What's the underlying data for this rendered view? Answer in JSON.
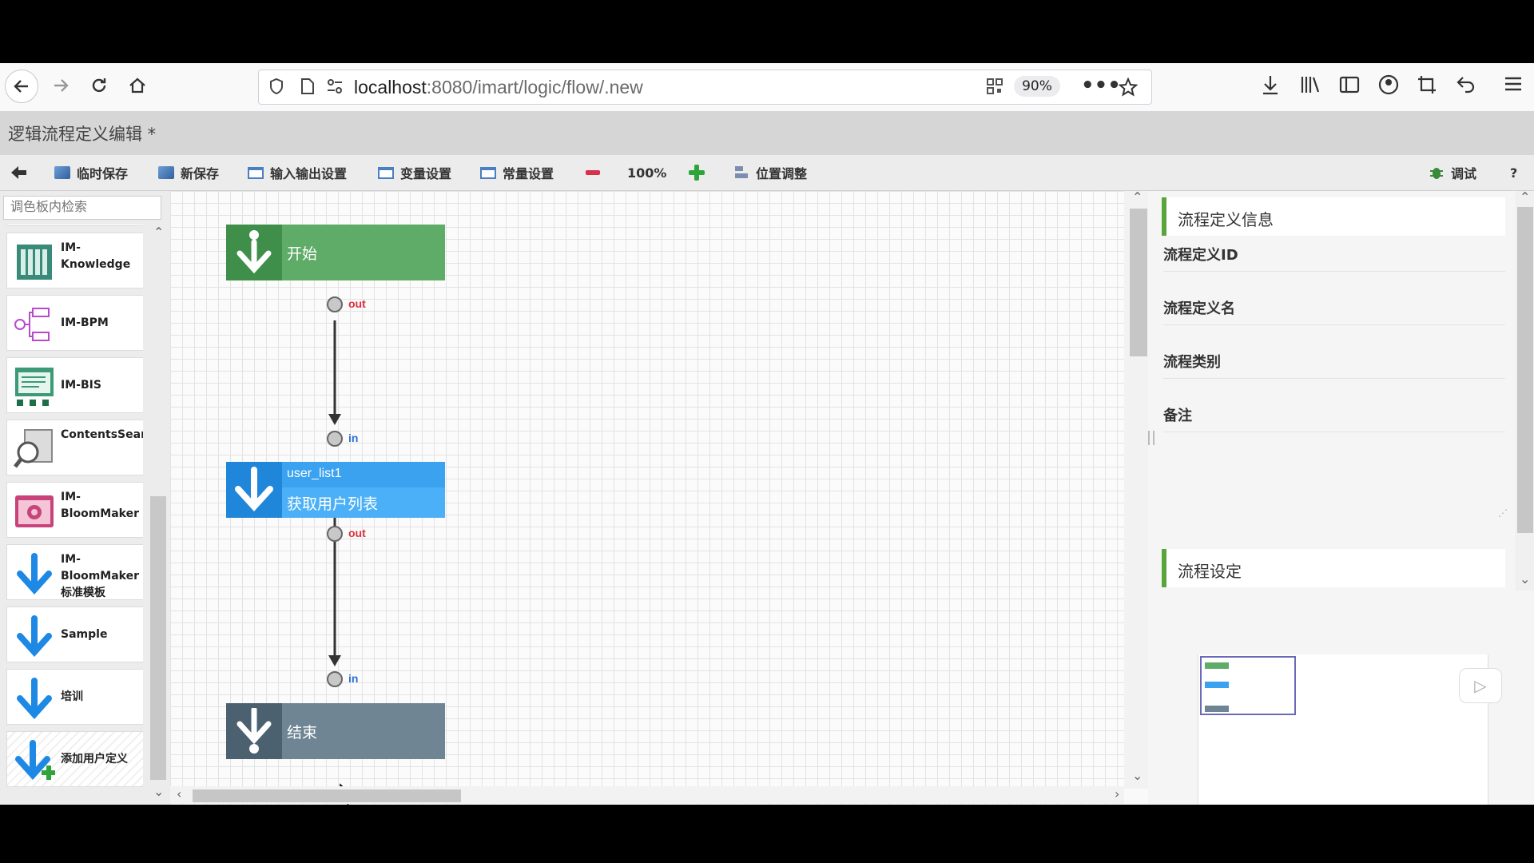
{
  "browser": {
    "url_host": "localhost",
    "url_path": ":8080/imart/logic/flow/.new",
    "zoom": "90%"
  },
  "page": {
    "title": "逻辑流程定义编辑 *"
  },
  "toolbar": {
    "temp_save": "临时保存",
    "new_save": "新保存",
    "io_settings": "输入输出设置",
    "var_settings": "变量设置",
    "const_settings": "常量设置",
    "zoom": "100%",
    "position_adjust": "位置调整",
    "debug": "调试",
    "help": "?"
  },
  "palette": {
    "search_placeholder": "调色板内检索",
    "items": [
      {
        "label": "IM-Knowledge",
        "icon": "books-icon"
      },
      {
        "label": "IM-BPM",
        "icon": "flow-nodes-icon"
      },
      {
        "label": "IM-BIS",
        "icon": "form-screen-icon"
      },
      {
        "label": "ContentsSearch",
        "icon": "magnifier-doc-icon"
      },
      {
        "label": "IM-BloomMaker",
        "icon": "bloom-icon"
      },
      {
        "label": "IM-BloomMaker 标准模板",
        "icon": "down-arrow-icon"
      },
      {
        "label": "Sample",
        "icon": "down-arrow-icon"
      },
      {
        "label": "培训",
        "icon": "down-arrow-icon"
      },
      {
        "label": "添加用户定义",
        "icon": "down-arrow-plus-icon"
      }
    ]
  },
  "flow": {
    "start": {
      "label": "开始"
    },
    "task": {
      "id": "user_list1",
      "name": "获取用户列表"
    },
    "end": {
      "label": "结束"
    },
    "ports": {
      "out": "out",
      "in": "in"
    }
  },
  "properties": {
    "info_header": "流程定义信息",
    "fields": [
      "流程定义ID",
      "流程定义名",
      "流程类别",
      "备注"
    ],
    "settings_header": "流程设定"
  },
  "colors": {
    "start": "#5fab68",
    "task": "#3ba2f0",
    "end": "#6f8594",
    "section_accent": "#5aa43c"
  }
}
